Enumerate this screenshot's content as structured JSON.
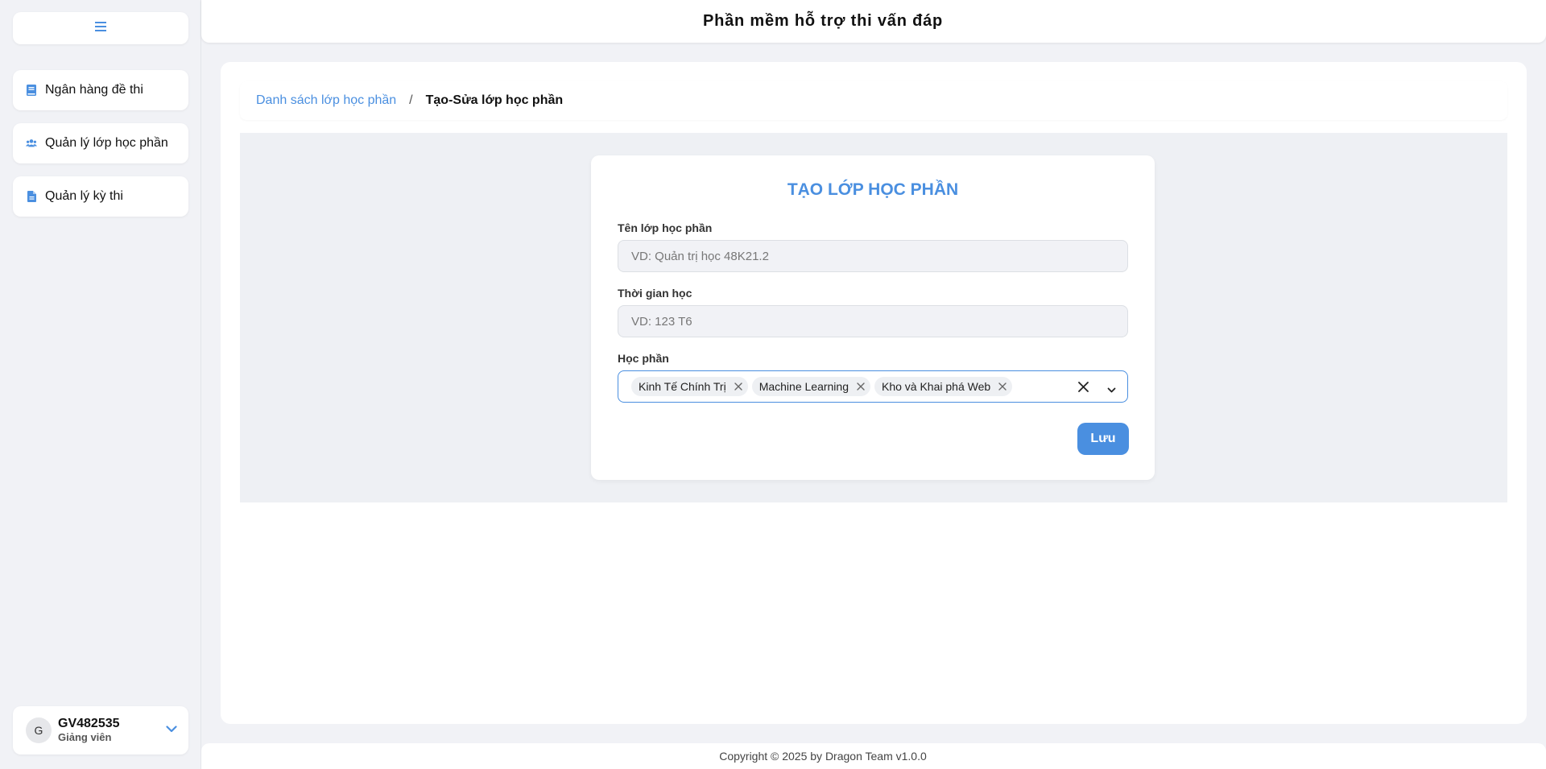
{
  "app": {
    "title": "Phần mềm hỗ trợ thi vấn đáp",
    "accent_color": "#4a8fe0"
  },
  "sidebar": {
    "toggle_icon": "hamburger-icon",
    "items": [
      {
        "label": "Ngân hàng đề thi",
        "icon": "book-icon"
      },
      {
        "label": "Quản lý lớp học phần",
        "icon": "users-icon"
      },
      {
        "label": "Quản lý kỳ thi",
        "icon": "file-icon"
      }
    ],
    "user": {
      "avatar_letter": "G",
      "name": "GV482535",
      "role": "Giảng viên"
    }
  },
  "breadcrumb": {
    "parent": "Danh sách lớp học phần",
    "separator": "/",
    "current": "Tạo-Sửa lớp học phần"
  },
  "form": {
    "title": "TẠO LỚP HỌC PHẦN",
    "class_name": {
      "label": "Tên lớp học phần",
      "placeholder": "VD: Quản trị học 48K21.2",
      "value": ""
    },
    "schedule": {
      "label": "Thời gian học",
      "placeholder": "VD: 123 T6",
      "value": ""
    },
    "courses": {
      "label": "Học phần",
      "selected": [
        "Kinh Tế Chính Trị",
        "Machine Learning",
        "Kho và Khai phá Web"
      ]
    },
    "save_label": "Lưu"
  },
  "footer": {
    "text": "Copyright © 2025 by Dragon Team v1.0.0"
  }
}
